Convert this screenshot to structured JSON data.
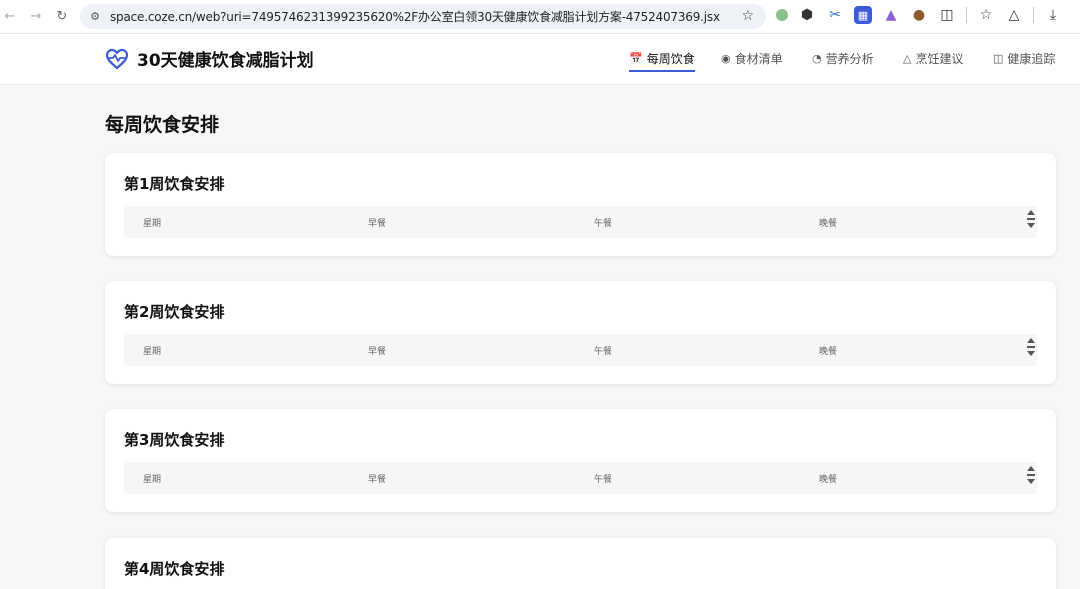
{
  "browser": {
    "url": "space.coze.cn/web?uri=7495746231399235620%2F办公室白领30天健康饮食减脂计划方案-4752407369.jsx"
  },
  "app": {
    "title": "30天健康饮食减脂计划",
    "nav": [
      {
        "label": "每周饮食",
        "icon": "calendar-icon",
        "active": true
      },
      {
        "label": "食材清单",
        "icon": "basket-icon",
        "active": false
      },
      {
        "label": "营养分析",
        "icon": "pie-chart-icon",
        "active": false
      },
      {
        "label": "烹饪建议",
        "icon": "chef-hat-icon",
        "active": false
      },
      {
        "label": "健康追踪",
        "icon": "book-icon",
        "active": false
      }
    ]
  },
  "page": {
    "title": "每周饮食安排",
    "columns": [
      "星期",
      "早餐",
      "午餐",
      "晚餐"
    ],
    "weeks": [
      {
        "title": "第1周饮食安排"
      },
      {
        "title": "第2周饮食安排"
      },
      {
        "title": "第3周饮食安排"
      },
      {
        "title": "第4周饮食安排"
      }
    ]
  },
  "colors": {
    "accent": "#3b5bdb",
    "heart": "#3b5bdb"
  }
}
